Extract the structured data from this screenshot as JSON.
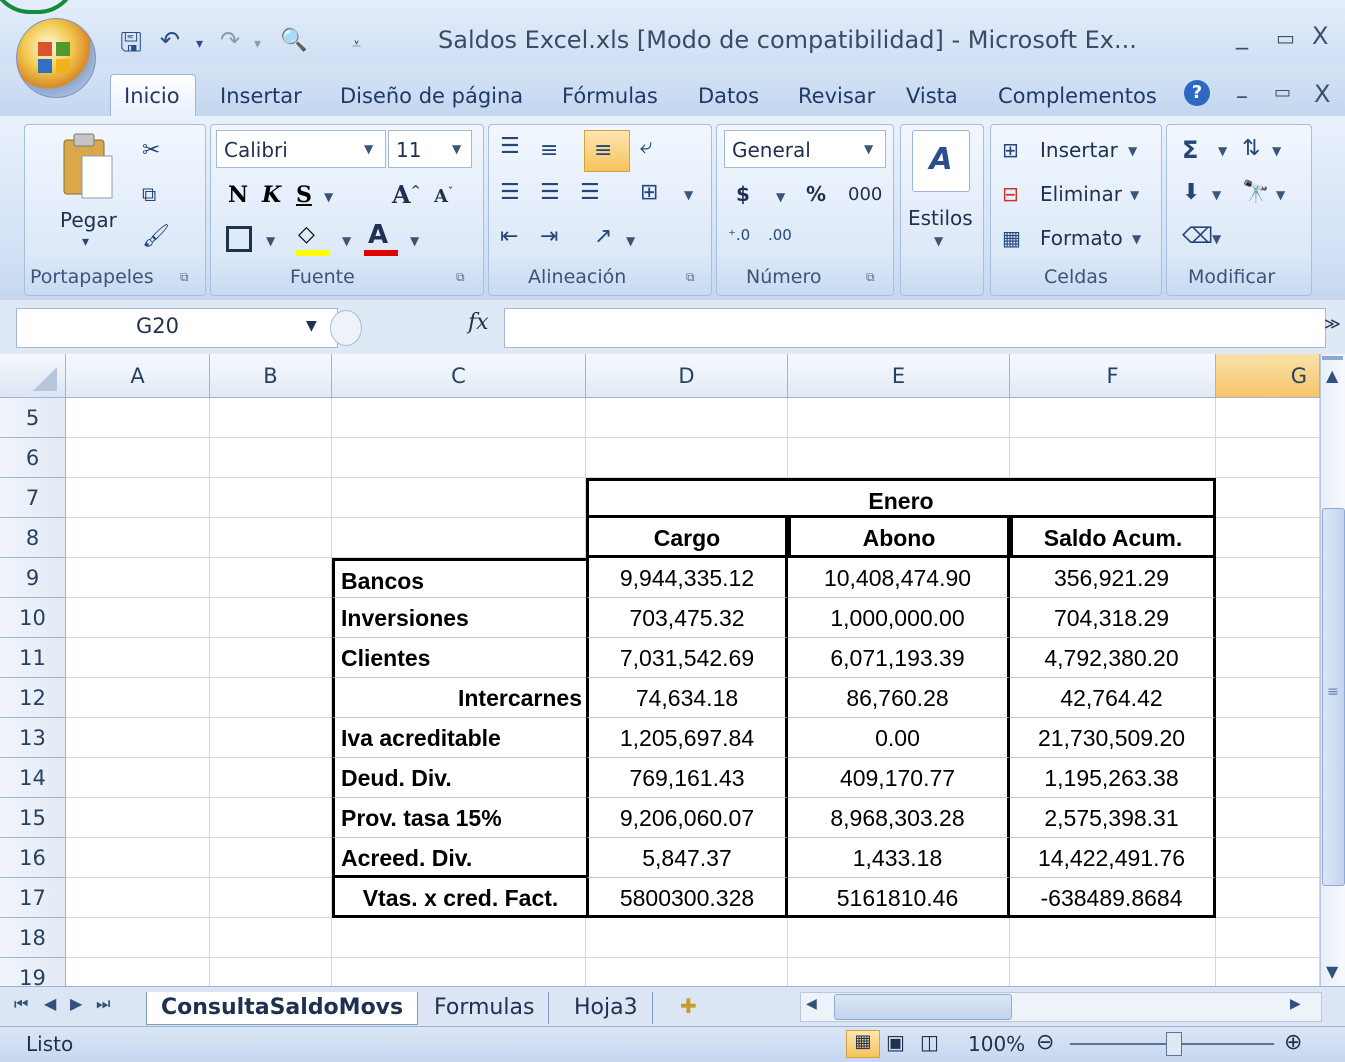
{
  "window": {
    "title": "Saldos Excel.xls  [Modo de compatibilidad] - Microsoft Ex...",
    "min": "_",
    "max": "▭",
    "close": "X"
  },
  "tabs": [
    {
      "label": "Inicio"
    },
    {
      "label": "Insertar"
    },
    {
      "label": "Diseño de página"
    },
    {
      "label": "Fórmulas"
    },
    {
      "label": "Datos"
    },
    {
      "label": "Revisar"
    },
    {
      "label": "Vista"
    },
    {
      "label": "Complementos"
    }
  ],
  "ribbon": {
    "clipboard": {
      "label": "Portapapeles",
      "paste": "Pegar"
    },
    "font": {
      "label": "Fuente",
      "name": "Calibri",
      "size": "11",
      "bold": "N",
      "italic": "K",
      "underline": "S"
    },
    "alignment": {
      "label": "Alineación"
    },
    "number": {
      "label": "Número",
      "format": "General",
      "currency": "$",
      "percent": "%",
      "thousands": "000"
    },
    "styles": {
      "label": "Estilos"
    },
    "cells": {
      "label": "Celdas",
      "insert": "Insertar",
      "delete": "Eliminar",
      "format": "Formato"
    },
    "editing": {
      "label": "Modificar"
    }
  },
  "formula_bar": {
    "namebox": "G20",
    "fx": "fx",
    "value": ""
  },
  "columns": [
    "A",
    "B",
    "C",
    "D",
    "E",
    "F",
    "G"
  ],
  "row_numbers": [
    "5",
    "6",
    "7",
    "8",
    "9",
    "10",
    "11",
    "12",
    "13",
    "14",
    "15",
    "16",
    "17",
    "18",
    "19"
  ],
  "table": {
    "month": "Enero",
    "headers": [
      "Cargo",
      "Abono",
      "Saldo Acum."
    ],
    "rows": [
      {
        "label": "Bancos",
        "cargo": "9,944,335.12",
        "abono": "10,408,474.90",
        "saldo": "356,921.29"
      },
      {
        "label": "Inversiones",
        "cargo": "703,475.32",
        "abono": "1,000,000.00",
        "saldo": "704,318.29"
      },
      {
        "label": "Clientes",
        "cargo": "7,031,542.69",
        "abono": "6,071,193.39",
        "saldo": "4,792,380.20"
      },
      {
        "label": "Intercarnes",
        "cargo": "74,634.18",
        "abono": "86,760.28",
        "saldo": "42,764.42"
      },
      {
        "label": "Iva acreditable",
        "cargo": "1,205,697.84",
        "abono": "0.00",
        "saldo": "21,730,509.20"
      },
      {
        "label": "Deud. Div.",
        "cargo": "769,161.43",
        "abono": "409,170.77",
        "saldo": "1,195,263.38"
      },
      {
        "label": "Prov. tasa 15%",
        "cargo": "9,206,060.07",
        "abono": "8,968,303.28",
        "saldo": "2,575,398.31"
      },
      {
        "label": "Acreed. Div.",
        "cargo": "5,847.37",
        "abono": "1,433.18",
        "saldo": "14,422,491.76"
      },
      {
        "label": "Vtas. x cred. Fact.",
        "cargo": "5800300.328",
        "abono": "5161810.46",
        "saldo": "-638489.8684"
      }
    ]
  },
  "sheets": [
    {
      "label": "ConsultaSaldoMovs"
    },
    {
      "label": "Formulas"
    },
    {
      "label": "Hoja3"
    }
  ],
  "status": {
    "text": "Listo",
    "zoom": "100%"
  }
}
